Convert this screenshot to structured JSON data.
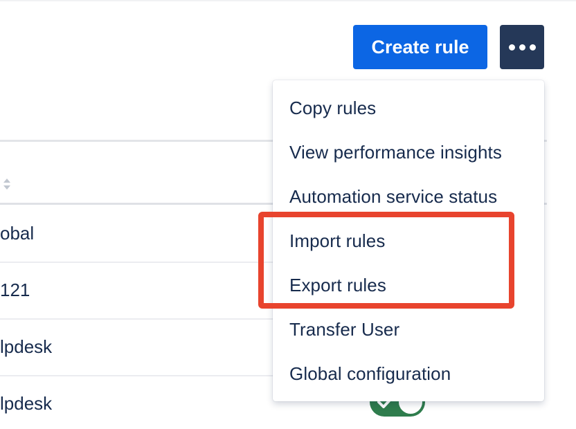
{
  "header": {
    "create_rule_label": "Create rule",
    "more_icon": "more-horizontal-icon"
  },
  "table": {
    "sort_icon": "sort-icon",
    "rows": [
      {
        "scope": "obal"
      },
      {
        "scope": "121"
      },
      {
        "scope": "lpdesk"
      },
      {
        "scope": "lpdesk"
      }
    ],
    "toggle": {
      "state": "on",
      "icon": "check-icon"
    }
  },
  "menu": {
    "items": [
      {
        "label": "Copy rules"
      },
      {
        "label": "View performance insights"
      },
      {
        "label": "Automation service status"
      },
      {
        "label": "Import rules"
      },
      {
        "label": "Export rules"
      },
      {
        "label": "Transfer User"
      },
      {
        "label": "Global configuration"
      }
    ]
  },
  "colors": {
    "primary_button": "#0c66e4",
    "more_button": "#253858",
    "text": "#172b4d",
    "toggle_on": "#2f7d4d",
    "annotation": "#e8442e"
  }
}
